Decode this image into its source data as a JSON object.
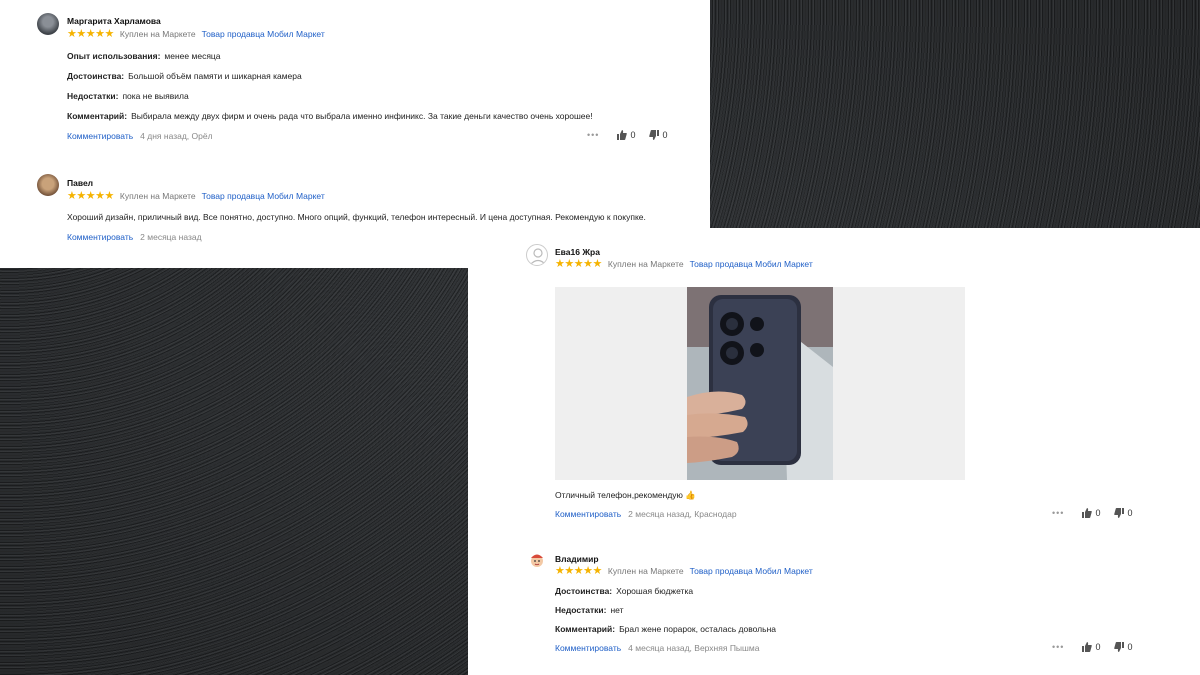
{
  "reviews": [
    {
      "author": "Маргарита Харламова",
      "bought": "Куплен на Маркете",
      "seller": "Товар продавца Мобил Маркет",
      "lines": [
        {
          "label": "Опыт использования:",
          "text": "менее месяца"
        },
        {
          "label": "Достоинства:",
          "text": "Большой объём памяти и шикарная камера"
        },
        {
          "label": "Недостатки:",
          "text": "пока не выявила"
        },
        {
          "label": "Комментарий:",
          "text": "Выбирала между двух фирм и очень рада что выбрала именно инфиникс. За такие деньги качество очень хорошее!"
        }
      ],
      "comment_link": "Комментировать",
      "ago": "4 дня назад, Орёл",
      "likes": "0",
      "dislikes": "0"
    },
    {
      "author": "Павел",
      "bought": "Куплен на Маркете",
      "seller": "Товар продавца Мобил Маркет",
      "text": "Хороший дизайн, приличный вид. Все понятно, доступно. Много опций, функций, телефон интересный. И цена доступная. Рекомендую к покупке.",
      "comment_link": "Комментировать",
      "ago": "2 месяца назад"
    },
    {
      "author": "Ева16 Жра",
      "bought": "Куплен на Маркете",
      "seller": "Товар продавца Мобил Маркет",
      "text": "Отличный телефон,рекомендую 👍",
      "comment_link": "Комментировать",
      "ago": "2 месяца назад, Краснодар",
      "likes": "0",
      "dislikes": "0"
    },
    {
      "author": "Владимир",
      "bought": "Куплен на Маркете",
      "seller": "Товар продавца Мобил Маркет",
      "lines": [
        {
          "label": "Достоинства:",
          "text": "Хорошая бюджетка"
        },
        {
          "label": "Недостатки:",
          "text": "нет"
        },
        {
          "label": "Комментарий:",
          "text": "Брал жене порарок, осталась довольна"
        }
      ],
      "comment_link": "Комментировать",
      "ago": "4 месяца назад, Верхняя Пышма",
      "likes": "0",
      "dislikes": "0"
    }
  ],
  "colors": {
    "star": "#f5b301",
    "link": "#1f5fc7"
  },
  "icons": {
    "more": "more-dots-icon",
    "like": "thumb-up-icon",
    "dislike": "thumb-down-icon"
  }
}
